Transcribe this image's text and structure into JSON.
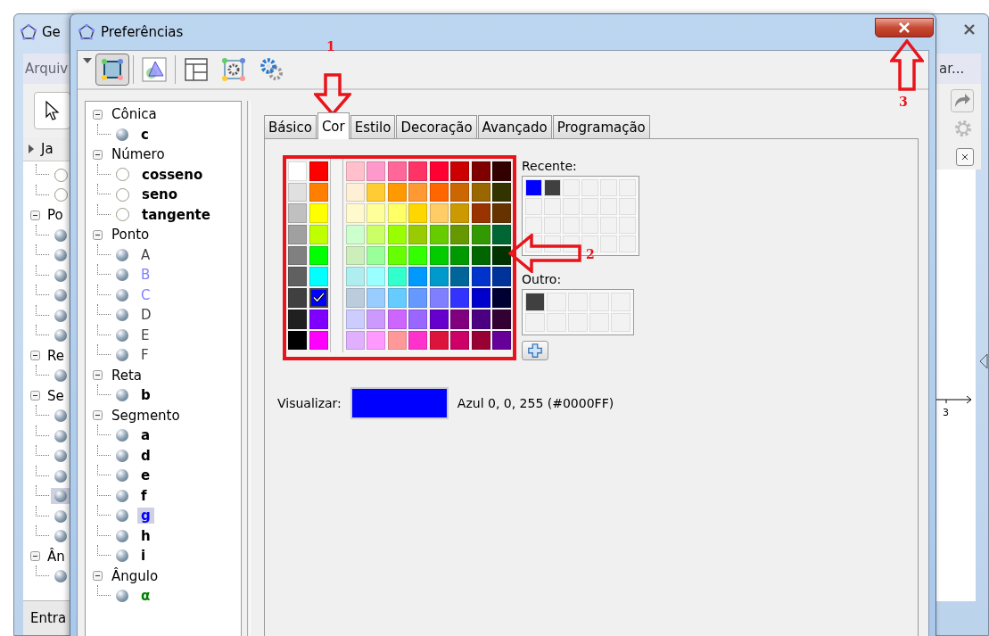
{
  "background_window": {
    "title": "Ge",
    "menu_left": "Arquiv",
    "menu_right": "ar...",
    "panel_header": "Ja",
    "tree": [
      {
        "children": [
          {
            "visible": false,
            "selected": false
          },
          {
            "visible": false,
            "selected": false
          }
        ]
      },
      {
        "label": "Po",
        "expanded": true,
        "children": [
          {
            "visible": true,
            "selected": false
          },
          {
            "visible": true,
            "selected": false
          },
          {
            "visible": true,
            "selected": false
          },
          {
            "visible": true,
            "selected": false
          },
          {
            "visible": true,
            "selected": false
          },
          {
            "visible": true,
            "selected": false
          }
        ]
      },
      {
        "label": "Re",
        "expanded": true,
        "children": [
          {
            "visible": true,
            "selected": false
          }
        ]
      },
      {
        "label": "Se",
        "expanded": true,
        "children": [
          {
            "visible": true,
            "selected": false
          },
          {
            "visible": true,
            "selected": false
          },
          {
            "visible": true,
            "selected": false
          },
          {
            "visible": true,
            "selected": false
          },
          {
            "visible": true,
            "selected": true
          },
          {
            "visible": true,
            "selected": false
          },
          {
            "visible": true,
            "selected": false
          }
        ]
      },
      {
        "label": "Ân",
        "expanded": true,
        "children": [
          {
            "visible": true,
            "selected": false
          }
        ]
      }
    ],
    "input_label": "Entra",
    "axis_tick": "3"
  },
  "dialog": {
    "title": "Preferências",
    "toolbar": [
      {
        "kind": "object",
        "selected": true
      },
      {
        "kind": "graphics",
        "selected": false
      },
      {
        "kind": "layout",
        "selected": false
      },
      {
        "kind": "defaults",
        "selected": false
      },
      {
        "kind": "advanced",
        "selected": false
      }
    ],
    "tree": [
      {
        "label": "Cônica",
        "expanded": true,
        "children": [
          {
            "label": "c",
            "visible": true,
            "bold": true,
            "color": "#000000",
            "selected": false
          }
        ]
      },
      {
        "label": "Número",
        "expanded": true,
        "children": [
          {
            "label": "cosseno",
            "visible": false,
            "bold": true,
            "color": "#000000",
            "selected": false
          },
          {
            "label": "seno",
            "visible": false,
            "bold": true,
            "color": "#000000",
            "selected": false
          },
          {
            "label": "tangente",
            "visible": false,
            "bold": true,
            "color": "#000000",
            "selected": false
          }
        ]
      },
      {
        "label": "Ponto",
        "expanded": true,
        "children": [
          {
            "label": "A",
            "visible": true,
            "bold": false,
            "color": "#444444",
            "selected": false
          },
          {
            "label": "B",
            "visible": true,
            "bold": false,
            "color": "#7f7fff",
            "selected": false
          },
          {
            "label": "C",
            "visible": true,
            "bold": false,
            "color": "#7f7fff",
            "selected": false
          },
          {
            "label": "D",
            "visible": true,
            "bold": false,
            "color": "#444444",
            "selected": false
          },
          {
            "label": "E",
            "visible": true,
            "bold": false,
            "color": "#444444",
            "selected": false
          },
          {
            "label": "F",
            "visible": true,
            "bold": false,
            "color": "#444444",
            "selected": false
          }
        ]
      },
      {
        "label": "Reta",
        "expanded": true,
        "children": [
          {
            "label": "b",
            "visible": true,
            "bold": true,
            "color": "#000000",
            "selected": false
          }
        ]
      },
      {
        "label": "Segmento",
        "expanded": true,
        "children": [
          {
            "label": "a",
            "visible": true,
            "bold": true,
            "color": "#000000",
            "selected": false
          },
          {
            "label": "d",
            "visible": true,
            "bold": true,
            "color": "#000000",
            "selected": false
          },
          {
            "label": "e",
            "visible": true,
            "bold": true,
            "color": "#000000",
            "selected": false
          },
          {
            "label": "f",
            "visible": true,
            "bold": true,
            "color": "#000000",
            "selected": false
          },
          {
            "label": "g",
            "visible": true,
            "bold": true,
            "color": "#0000ff",
            "selected": true
          },
          {
            "label": "h",
            "visible": true,
            "bold": true,
            "color": "#000000",
            "selected": false
          },
          {
            "label": "i",
            "visible": true,
            "bold": true,
            "color": "#000000",
            "selected": false
          }
        ]
      },
      {
        "label": "Ângulo",
        "expanded": true,
        "children": [
          {
            "label": "α",
            "visible": true,
            "bold": true,
            "color": "#007f00",
            "selected": false
          }
        ]
      }
    ],
    "tabs": [
      {
        "label": "Básico",
        "selected": false
      },
      {
        "label": "Cor",
        "selected": true
      },
      {
        "label": "Estilo",
        "selected": false
      },
      {
        "label": "Decoração",
        "selected": false
      },
      {
        "label": "Avançado",
        "selected": false
      },
      {
        "label": "Programação",
        "selected": false
      }
    ],
    "palette": [
      [
        {
          "color": "#ffffff",
          "selected": false
        },
        {
          "color": "#ff0000",
          "selected": false
        },
        {
          "color": "#ffc0cb",
          "selected": false
        },
        {
          "color": "#ff99cc",
          "selected": false
        },
        {
          "color": "#ff6699",
          "selected": false
        },
        {
          "color": "#ff3366",
          "selected": false
        },
        {
          "color": "#ff0033",
          "selected": false
        },
        {
          "color": "#cc0000",
          "selected": false
        },
        {
          "color": "#800000",
          "selected": false
        },
        {
          "color": "#330000",
          "selected": false
        }
      ],
      [
        {
          "color": "#e0e0e0",
          "selected": false
        },
        {
          "color": "#ff7f00",
          "selected": false
        },
        {
          "color": "#ffefd5",
          "selected": false
        },
        {
          "color": "#ffcc33",
          "selected": false
        },
        {
          "color": "#ff9900",
          "selected": false
        },
        {
          "color": "#ff9933",
          "selected": false
        },
        {
          "color": "#ff6600",
          "selected": false
        },
        {
          "color": "#cc6600",
          "selected": false
        },
        {
          "color": "#996600",
          "selected": false
        },
        {
          "color": "#333300",
          "selected": false
        }
      ],
      [
        {
          "color": "#c0c0c0",
          "selected": false
        },
        {
          "color": "#ffff00",
          "selected": false
        },
        {
          "color": "#fffacd",
          "selected": false
        },
        {
          "color": "#ffff99",
          "selected": false
        },
        {
          "color": "#ffff66",
          "selected": false
        },
        {
          "color": "#ffd700",
          "selected": false
        },
        {
          "color": "#ffcc66",
          "selected": false
        },
        {
          "color": "#cc9900",
          "selected": false
        },
        {
          "color": "#993300",
          "selected": false
        },
        {
          "color": "#663300",
          "selected": false
        }
      ],
      [
        {
          "color": "#a0a0a0",
          "selected": false
        },
        {
          "color": "#bfff00",
          "selected": false
        },
        {
          "color": "#ccffcc",
          "selected": false
        },
        {
          "color": "#ccff66",
          "selected": false
        },
        {
          "color": "#99ff00",
          "selected": false
        },
        {
          "color": "#99cc00",
          "selected": false
        },
        {
          "color": "#66cc00",
          "selected": false
        },
        {
          "color": "#669900",
          "selected": false
        },
        {
          "color": "#339900",
          "selected": false
        },
        {
          "color": "#006633",
          "selected": false
        }
      ],
      [
        {
          "color": "#808080",
          "selected": false
        },
        {
          "color": "#00ff00",
          "selected": false
        },
        {
          "color": "#cceebb",
          "selected": false
        },
        {
          "color": "#99ff99",
          "selected": false
        },
        {
          "color": "#66ff00",
          "selected": false
        },
        {
          "color": "#33ff00",
          "selected": false
        },
        {
          "color": "#00cc00",
          "selected": false
        },
        {
          "color": "#009900",
          "selected": false
        },
        {
          "color": "#006600",
          "selected": false
        },
        {
          "color": "#003300",
          "selected": false
        }
      ],
      [
        {
          "color": "#606060",
          "selected": false
        },
        {
          "color": "#00ffff",
          "selected": false
        },
        {
          "color": "#afeeee",
          "selected": false
        },
        {
          "color": "#99ffff",
          "selected": false
        },
        {
          "color": "#33ffcc",
          "selected": false
        },
        {
          "color": "#0099ff",
          "selected": false
        },
        {
          "color": "#0099cc",
          "selected": false
        },
        {
          "color": "#006699",
          "selected": false
        },
        {
          "color": "#0033cc",
          "selected": false
        },
        {
          "color": "#003399",
          "selected": false
        }
      ],
      [
        {
          "color": "#404040",
          "selected": false
        },
        {
          "color": "#0000ff",
          "selected": true
        },
        {
          "color": "#bbccdd",
          "selected": false
        },
        {
          "color": "#99ccff",
          "selected": false
        },
        {
          "color": "#66ccff",
          "selected": false
        },
        {
          "color": "#6699ff",
          "selected": false
        },
        {
          "color": "#7f7fff",
          "selected": false
        },
        {
          "color": "#3333ff",
          "selected": false
        },
        {
          "color": "#0000cc",
          "selected": false
        },
        {
          "color": "#000033",
          "selected": false
        }
      ],
      [
        {
          "color": "#202020",
          "selected": false
        },
        {
          "color": "#7f00ff",
          "selected": false
        },
        {
          "color": "#ccccff",
          "selected": false
        },
        {
          "color": "#cc99ff",
          "selected": false
        },
        {
          "color": "#cc66ff",
          "selected": false
        },
        {
          "color": "#9966ff",
          "selected": false
        },
        {
          "color": "#6600cc",
          "selected": false
        },
        {
          "color": "#800080",
          "selected": false
        },
        {
          "color": "#4b0082",
          "selected": false
        },
        {
          "color": "#330033",
          "selected": false
        }
      ],
      [
        {
          "color": "#000000",
          "selected": false
        },
        {
          "color": "#ff00ff",
          "selected": false
        },
        {
          "color": "#e0b0ff",
          "selected": false
        },
        {
          "color": "#ff99ff",
          "selected": false
        },
        {
          "color": "#ff9999",
          "selected": false
        },
        {
          "color": "#ff33cc",
          "selected": false
        },
        {
          "color": "#dc143c",
          "selected": false
        },
        {
          "color": "#cc0066",
          "selected": false
        },
        {
          "color": "#990033",
          "selected": false
        },
        {
          "color": "#660099",
          "selected": false
        }
      ]
    ],
    "recent_label": "Recente:",
    "recent": [
      {
        "color": "#0000ff"
      },
      {
        "color": "#404040"
      }
    ],
    "other_label": "Outro:",
    "other": [
      {
        "color": "#404040"
      }
    ],
    "preview_label": "Visualizar:",
    "preview": {
      "color": "#0000ff"
    },
    "preview_text": "Azul 0, 0, 255 (#0000FF)"
  },
  "annotations": [
    {
      "label": "1"
    },
    {
      "label": "2"
    },
    {
      "label": "3"
    }
  ]
}
